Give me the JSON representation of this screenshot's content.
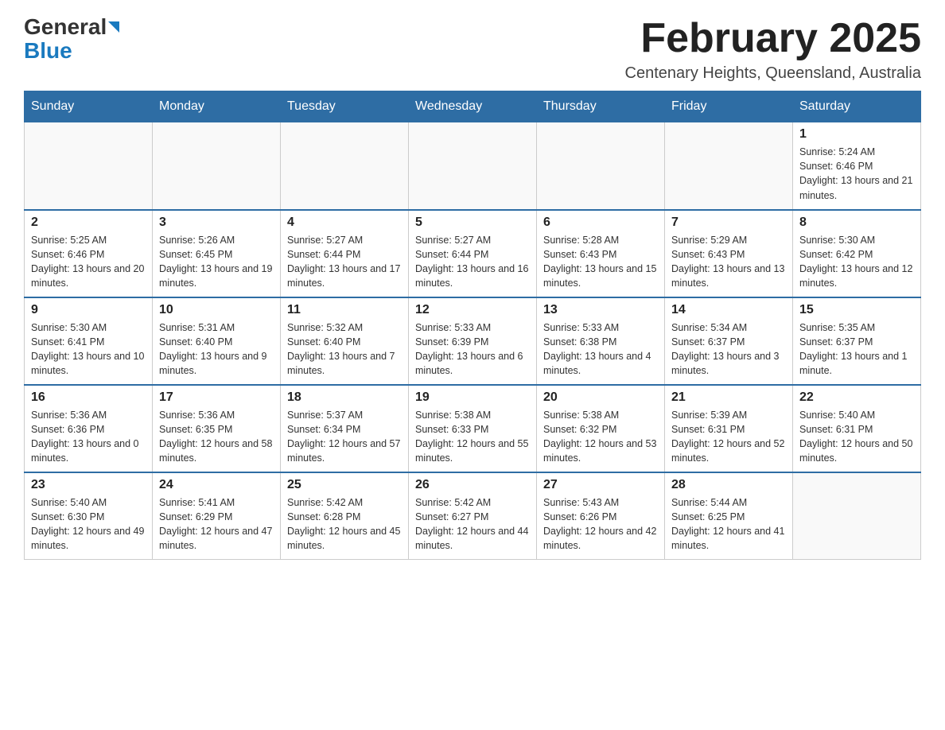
{
  "header": {
    "logo_general": "General",
    "logo_blue": "Blue",
    "month_title": "February 2025",
    "location": "Centenary Heights, Queensland, Australia"
  },
  "days_of_week": [
    "Sunday",
    "Monday",
    "Tuesday",
    "Wednesday",
    "Thursday",
    "Friday",
    "Saturday"
  ],
  "weeks": [
    {
      "cells": [
        {
          "day": null
        },
        {
          "day": null
        },
        {
          "day": null
        },
        {
          "day": null
        },
        {
          "day": null
        },
        {
          "day": null
        },
        {
          "day": "1",
          "sunrise": "Sunrise: 5:24 AM",
          "sunset": "Sunset: 6:46 PM",
          "daylight": "Daylight: 13 hours and 21 minutes."
        }
      ]
    },
    {
      "cells": [
        {
          "day": "2",
          "sunrise": "Sunrise: 5:25 AM",
          "sunset": "Sunset: 6:46 PM",
          "daylight": "Daylight: 13 hours and 20 minutes."
        },
        {
          "day": "3",
          "sunrise": "Sunrise: 5:26 AM",
          "sunset": "Sunset: 6:45 PM",
          "daylight": "Daylight: 13 hours and 19 minutes."
        },
        {
          "day": "4",
          "sunrise": "Sunrise: 5:27 AM",
          "sunset": "Sunset: 6:44 PM",
          "daylight": "Daylight: 13 hours and 17 minutes."
        },
        {
          "day": "5",
          "sunrise": "Sunrise: 5:27 AM",
          "sunset": "Sunset: 6:44 PM",
          "daylight": "Daylight: 13 hours and 16 minutes."
        },
        {
          "day": "6",
          "sunrise": "Sunrise: 5:28 AM",
          "sunset": "Sunset: 6:43 PM",
          "daylight": "Daylight: 13 hours and 15 minutes."
        },
        {
          "day": "7",
          "sunrise": "Sunrise: 5:29 AM",
          "sunset": "Sunset: 6:43 PM",
          "daylight": "Daylight: 13 hours and 13 minutes."
        },
        {
          "day": "8",
          "sunrise": "Sunrise: 5:30 AM",
          "sunset": "Sunset: 6:42 PM",
          "daylight": "Daylight: 13 hours and 12 minutes."
        }
      ]
    },
    {
      "cells": [
        {
          "day": "9",
          "sunrise": "Sunrise: 5:30 AM",
          "sunset": "Sunset: 6:41 PM",
          "daylight": "Daylight: 13 hours and 10 minutes."
        },
        {
          "day": "10",
          "sunrise": "Sunrise: 5:31 AM",
          "sunset": "Sunset: 6:40 PM",
          "daylight": "Daylight: 13 hours and 9 minutes."
        },
        {
          "day": "11",
          "sunrise": "Sunrise: 5:32 AM",
          "sunset": "Sunset: 6:40 PM",
          "daylight": "Daylight: 13 hours and 7 minutes."
        },
        {
          "day": "12",
          "sunrise": "Sunrise: 5:33 AM",
          "sunset": "Sunset: 6:39 PM",
          "daylight": "Daylight: 13 hours and 6 minutes."
        },
        {
          "day": "13",
          "sunrise": "Sunrise: 5:33 AM",
          "sunset": "Sunset: 6:38 PM",
          "daylight": "Daylight: 13 hours and 4 minutes."
        },
        {
          "day": "14",
          "sunrise": "Sunrise: 5:34 AM",
          "sunset": "Sunset: 6:37 PM",
          "daylight": "Daylight: 13 hours and 3 minutes."
        },
        {
          "day": "15",
          "sunrise": "Sunrise: 5:35 AM",
          "sunset": "Sunset: 6:37 PM",
          "daylight": "Daylight: 13 hours and 1 minute."
        }
      ]
    },
    {
      "cells": [
        {
          "day": "16",
          "sunrise": "Sunrise: 5:36 AM",
          "sunset": "Sunset: 6:36 PM",
          "daylight": "Daylight: 13 hours and 0 minutes."
        },
        {
          "day": "17",
          "sunrise": "Sunrise: 5:36 AM",
          "sunset": "Sunset: 6:35 PM",
          "daylight": "Daylight: 12 hours and 58 minutes."
        },
        {
          "day": "18",
          "sunrise": "Sunrise: 5:37 AM",
          "sunset": "Sunset: 6:34 PM",
          "daylight": "Daylight: 12 hours and 57 minutes."
        },
        {
          "day": "19",
          "sunrise": "Sunrise: 5:38 AM",
          "sunset": "Sunset: 6:33 PM",
          "daylight": "Daylight: 12 hours and 55 minutes."
        },
        {
          "day": "20",
          "sunrise": "Sunrise: 5:38 AM",
          "sunset": "Sunset: 6:32 PM",
          "daylight": "Daylight: 12 hours and 53 minutes."
        },
        {
          "day": "21",
          "sunrise": "Sunrise: 5:39 AM",
          "sunset": "Sunset: 6:31 PM",
          "daylight": "Daylight: 12 hours and 52 minutes."
        },
        {
          "day": "22",
          "sunrise": "Sunrise: 5:40 AM",
          "sunset": "Sunset: 6:31 PM",
          "daylight": "Daylight: 12 hours and 50 minutes."
        }
      ]
    },
    {
      "cells": [
        {
          "day": "23",
          "sunrise": "Sunrise: 5:40 AM",
          "sunset": "Sunset: 6:30 PM",
          "daylight": "Daylight: 12 hours and 49 minutes."
        },
        {
          "day": "24",
          "sunrise": "Sunrise: 5:41 AM",
          "sunset": "Sunset: 6:29 PM",
          "daylight": "Daylight: 12 hours and 47 minutes."
        },
        {
          "day": "25",
          "sunrise": "Sunrise: 5:42 AM",
          "sunset": "Sunset: 6:28 PM",
          "daylight": "Daylight: 12 hours and 45 minutes."
        },
        {
          "day": "26",
          "sunrise": "Sunrise: 5:42 AM",
          "sunset": "Sunset: 6:27 PM",
          "daylight": "Daylight: 12 hours and 44 minutes."
        },
        {
          "day": "27",
          "sunrise": "Sunrise: 5:43 AM",
          "sunset": "Sunset: 6:26 PM",
          "daylight": "Daylight: 12 hours and 42 minutes."
        },
        {
          "day": "28",
          "sunrise": "Sunrise: 5:44 AM",
          "sunset": "Sunset: 6:25 PM",
          "daylight": "Daylight: 12 hours and 41 minutes."
        },
        {
          "day": null
        }
      ]
    }
  ]
}
